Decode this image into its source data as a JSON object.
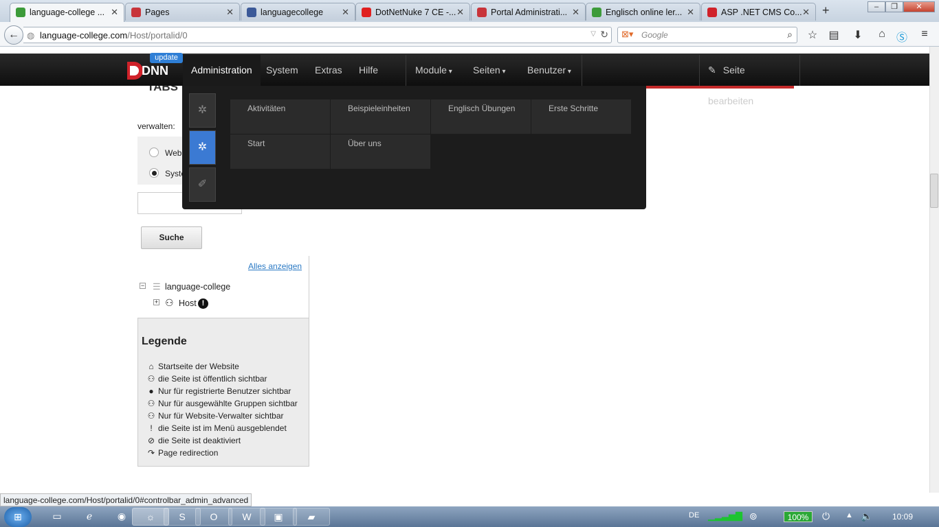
{
  "browser": {
    "tabs": [
      {
        "label": "language-college ...",
        "icon_color": "#3d9b3a",
        "active": true
      },
      {
        "label": "Pages",
        "icon_color": "#c8343a",
        "active": false
      },
      {
        "label": "languagecollege",
        "icon_color": "#3b5998",
        "active": false
      },
      {
        "label": "DotNetNuke 7 CE -...",
        "icon_color": "#e02020",
        "active": false
      },
      {
        "label": "Portal Administrati...",
        "icon_color": "#c8343a",
        "active": false
      },
      {
        "label": "Englisch online ler...",
        "icon_color": "#3d9b3a",
        "active": false
      },
      {
        "label": "ASP .NET CMS Co...",
        "icon_color": "#d0222a",
        "active": false
      }
    ],
    "new_tab": "+",
    "url_host": "language-college.com",
    "url_path": "/Host/portalid/0",
    "search_placeholder": "Google",
    "status_url": "language-college.com/Host/portalid/0#controlbar_admin_advanced"
  },
  "dnn": {
    "badge": "update",
    "menu": [
      "Administration",
      "System",
      "Extras",
      "Hilfe"
    ],
    "dropdown_menus": [
      "Module",
      "Seiten",
      "Benutzer"
    ],
    "edit_page": "Seite bearbeiten",
    "grid_items": [
      "Aktivitäten",
      "Beispieleinheiten",
      "Englisch Übungen",
      "Erste Schritte",
      "Start",
      "Über uns"
    ],
    "accent": "#3b7ad3"
  },
  "page": {
    "title_partial": "TABS",
    "manage_label": "verwalten:",
    "radio_1": "Web",
    "radio_2": "Syste",
    "search_button": "Suche",
    "show_all": "Alles anzeigen",
    "tree_root": "language-college",
    "tree_child": "Host",
    "legend_title": "Legende",
    "legend": [
      "Startseite der Website",
      "die Seite ist öffentlich sichtbar",
      "Nur für registrierte Benutzer sichtbar",
      "Nur für ausgewählte Gruppen sichtbar",
      "Nur für Website-Verwalter sichtbar",
      "die Seite ist im Menü ausgeblendet",
      "die Seite ist deaktiviert",
      "Page redirection"
    ]
  },
  "taskbar": {
    "lang": "DE",
    "battery": "100%",
    "clock": "10:09"
  }
}
